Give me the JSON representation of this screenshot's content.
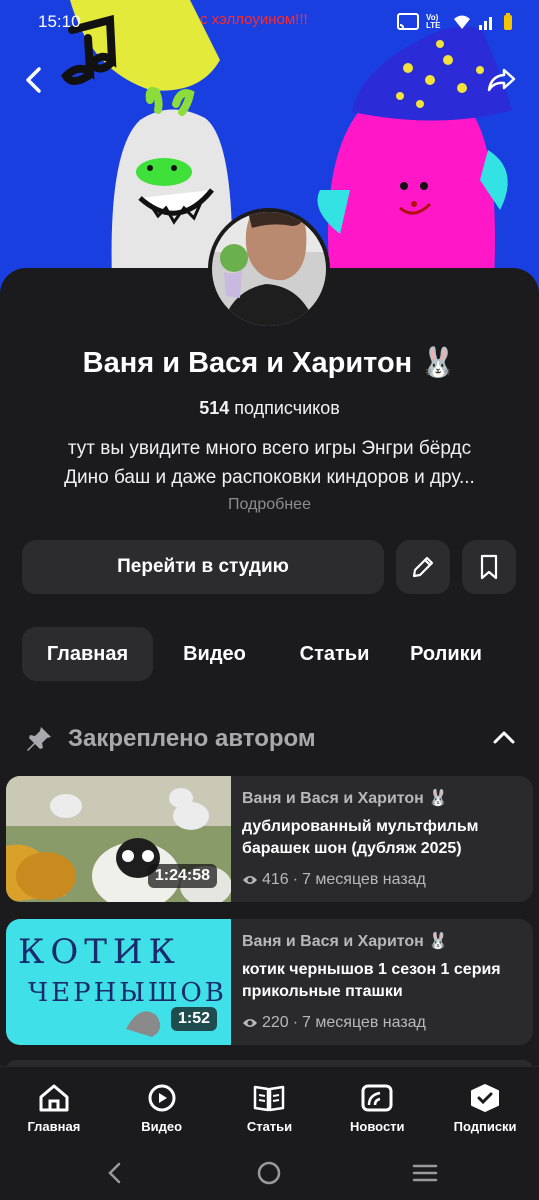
{
  "status_bar": {
    "time": "15:10",
    "network": "Vo) LTE"
  },
  "banner": {
    "caption": "с хэллоуином!!!"
  },
  "channel": {
    "title": "Ваня и Вася и Харитон 🐰",
    "subscribers_count": "514",
    "subscribers_label": "подписчиков",
    "description_line1": "тут вы увидите много всего игры  Энгри бёрдс",
    "description_line2": "Дино баш и даже распоковки киндоров и дру...",
    "more_label": "Подробнее"
  },
  "actions": {
    "studio_label": "Перейти в студию",
    "edit_icon": "pencil-icon",
    "bookmark_icon": "bookmark-icon"
  },
  "tabs": [
    {
      "label": "Главная",
      "active": true
    },
    {
      "label": "Видео",
      "active": false
    },
    {
      "label": "Статьи",
      "active": false
    },
    {
      "label": "Ролики",
      "active": false
    }
  ],
  "pinned_section": {
    "label": "Закреплено автором",
    "icon": "pin-icon"
  },
  "videos": [
    {
      "author": "Ваня и Вася и Харитон 🐰",
      "title": "дублированный мультфильм барашек шон (дубляж 2025)",
      "duration": "1:24:58",
      "views": "416",
      "age": "7 месяцев назад",
      "separator": "·"
    },
    {
      "author": "Ваня и Вася и Харитон 🐰",
      "title": "котик чернышов 1 сезон 1 серия прикольные пташки",
      "duration": "1:52",
      "views": "220",
      "age": "7 месяцев назад",
      "separator": "·",
      "thumb_text_line1": "КОТИК",
      "thumb_text_line2": "ЧЕРНЫШОВ"
    }
  ],
  "bottom_nav": [
    {
      "label": "Главная",
      "icon": "home-icon"
    },
    {
      "label": "Видео",
      "icon": "video-icon"
    },
    {
      "label": "Статьи",
      "icon": "articles-icon"
    },
    {
      "label": "Новости",
      "icon": "news-icon"
    },
    {
      "label": "Подписки",
      "icon": "subscriptions-icon"
    }
  ],
  "colors": {
    "background": "#1b1b1d",
    "card": "#2a2a2c",
    "button": "#2c2c2e",
    "banner_blue": "#1a3fe0",
    "muted_text": "#8c8c8f"
  }
}
